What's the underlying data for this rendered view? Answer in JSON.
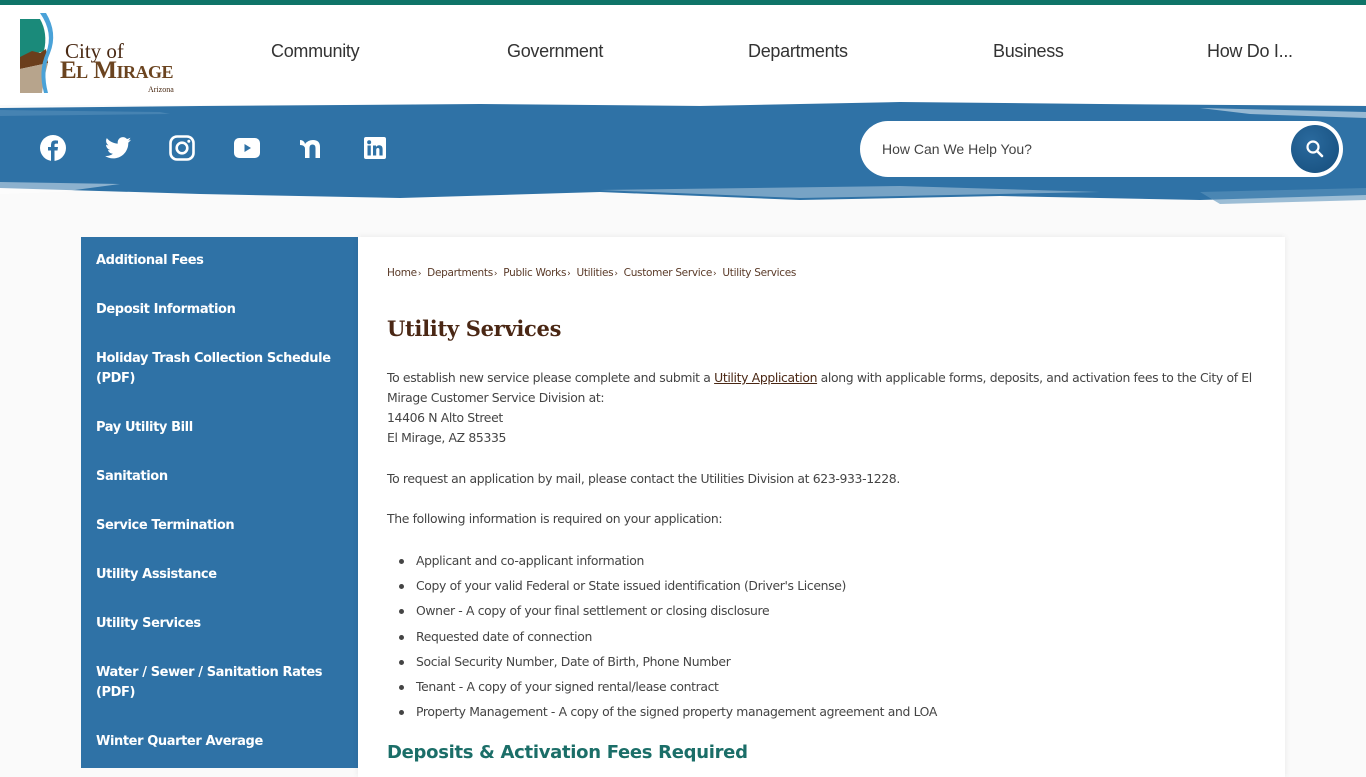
{
  "header": {
    "logo": {
      "line1": "City of",
      "line2": "El Mirage",
      "line3": "Arizona"
    },
    "nav": [
      {
        "label": "Community"
      },
      {
        "label": "Government"
      },
      {
        "label": "Departments"
      },
      {
        "label": "Business"
      },
      {
        "label": "How Do I..."
      }
    ]
  },
  "social": [
    {
      "icon": "facebook-icon"
    },
    {
      "icon": "twitter-icon"
    },
    {
      "icon": "instagram-icon"
    },
    {
      "icon": "youtube-icon"
    },
    {
      "icon": "nextdoor-icon"
    },
    {
      "icon": "linkedin-icon"
    }
  ],
  "search": {
    "placeholder": "How Can We Help You?",
    "value": "",
    "button_icon": "search-icon"
  },
  "sidebar": {
    "items": [
      {
        "label": "Additional Fees"
      },
      {
        "label": "Deposit Information"
      },
      {
        "label": "Holiday Trash Collection Schedule (PDF)"
      },
      {
        "label": "Pay Utility Bill"
      },
      {
        "label": "Sanitation"
      },
      {
        "label": "Service Termination"
      },
      {
        "label": "Utility Assistance"
      },
      {
        "label": "Utility Services"
      },
      {
        "label": "Water / Sewer / Sanitation Rates (PDF)"
      },
      {
        "label": "Winter Quarter Average"
      }
    ]
  },
  "breadcrumb": [
    {
      "label": "Home"
    },
    {
      "label": "Departments"
    },
    {
      "label": "Public Works"
    },
    {
      "label": "Utilities"
    },
    {
      "label": "Customer Service"
    },
    {
      "label": "Utility Services"
    }
  ],
  "main": {
    "title": "Utility Services",
    "intro": {
      "before_link": "To establish new service please complete and submit a ",
      "link": "Utility Application",
      "after_link": " along with applicable forms, deposits, and activation fees to the City of El Mirage Customer Service Division at:",
      "address_line1": "14406 N Alto Street",
      "address_line2": "El Mirage, AZ 85335"
    },
    "mail_request": "To request an application by mail, please contact the Utilities Division at 623-933-1228.",
    "required_intro": "The following information is required on your application:",
    "required_items": [
      "Applicant and co-applicant information",
      "Copy of your valid Federal or State issued identification (Driver's License)",
      "Owner - A copy of your final settlement or closing disclosure",
      "Requested date of connection",
      "Social Security Number, Date of Birth, Phone Number",
      "Tenant - A copy of your signed rental/lease contract",
      "Property Management - A copy of the signed property management agreement and LOA"
    ],
    "subheading": "Deposits & Activation Fees Required"
  },
  "colors": {
    "top_bar": "#0f7468",
    "banner_blue": "#2f72a6",
    "sidebar_blue": "#2f72a6",
    "title_brown": "#4a2714",
    "subheading_teal": "#1b6e68"
  }
}
